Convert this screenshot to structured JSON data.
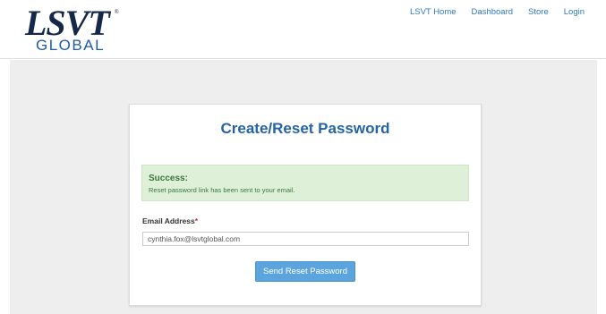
{
  "logo": {
    "top": "LSVT",
    "tm": "®",
    "bottom": "GLOBAL"
  },
  "nav": {
    "items": [
      {
        "label": "LSVT Home"
      },
      {
        "label": "Dashboard"
      },
      {
        "label": "Store"
      },
      {
        "label": "Login"
      }
    ]
  },
  "card": {
    "title": "Create/Reset Password",
    "alert": {
      "title": "Success:",
      "message": "Reset password link has been sent to your email."
    },
    "email": {
      "label": "Email Address",
      "required_mark": "*",
      "value": "cynthia.fox@lsvtglobal.com"
    },
    "submit_label": "Send Reset Password"
  },
  "colors": {
    "accent": "#2463a8",
    "button": "#5ba4dd",
    "success_bg": "#dff0d8",
    "success_text": "#3c763d",
    "required": "#c9302c",
    "page_bg": "#eeeeee"
  }
}
